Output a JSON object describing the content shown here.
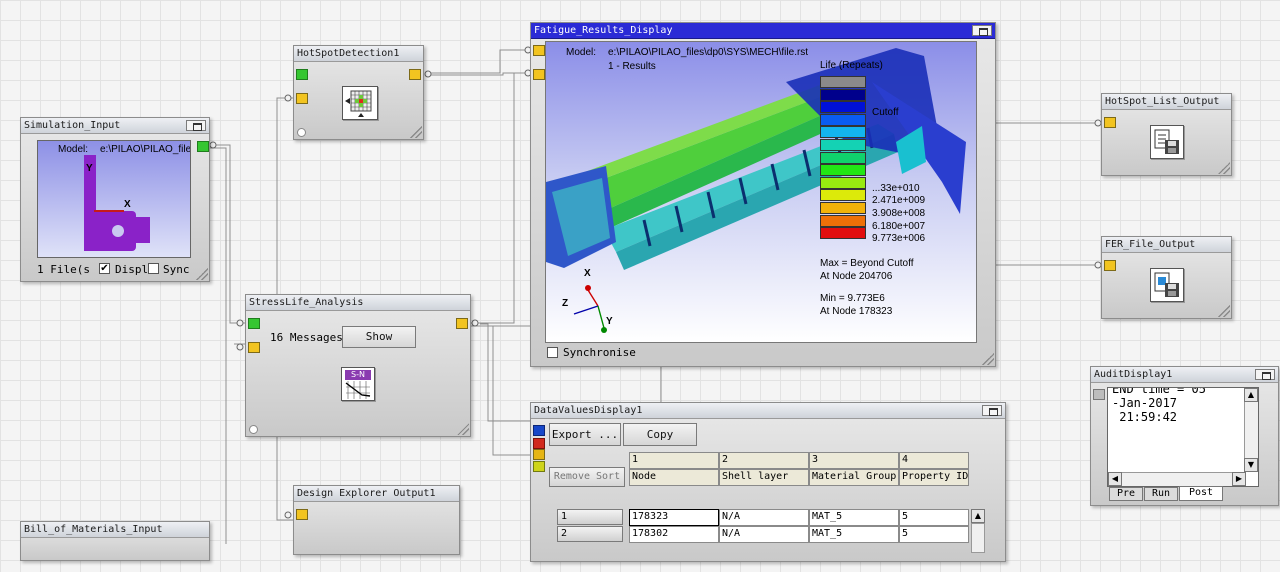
{
  "colors": {
    "port_yellow": "#f2c420",
    "port_green": "#35c631",
    "title_blue": "#2b2bd6",
    "wire": "#8a8a8a"
  },
  "simulation_input": {
    "title": "Simulation_Input",
    "model_label": "Model:",
    "model_path": "e:\\PILAO\\PILAO_file",
    "axis_y": "Y",
    "axis_x": "X",
    "files": "1 File(s",
    "display_label": "Displ",
    "sync_label": "Sync"
  },
  "hotspot_detection": {
    "title": "HotSpotDetection1",
    "icon": "hotspot-grid-icon"
  },
  "stresslife": {
    "title": "StressLife_Analysis",
    "messages": "16 Messages",
    "show_button": "Show",
    "icon_text": "S-N"
  },
  "design_explorer": {
    "title": "Design Explorer Output1"
  },
  "bill_of_materials": {
    "title": "Bill_of_Materials_Input"
  },
  "fatigue": {
    "title": "Fatigue_Results_Display",
    "model_label": "Model:",
    "model_path": "e:\\PILAO\\PILAO_files\\dp0\\SYS\\MECH\\file.rst",
    "results": "1 - Results",
    "legend_title": "Life (Repeats)",
    "legend_items": [
      {
        "label": "",
        "color": "#8a8a8a"
      },
      {
        "label": "",
        "color": "#00008c"
      },
      {
        "label": "Cutoff",
        "color": "#0010d8"
      },
      {
        "label": "",
        "color": "#0a5cf2"
      },
      {
        "label": "",
        "color": "#13b4ee"
      },
      {
        "label": "",
        "color": "#14d2b4"
      },
      {
        "label": "",
        "color": "#10d26c"
      },
      {
        "label": "",
        "color": "#22e614"
      },
      {
        "label": "...33e+010",
        "color": "#98ea10"
      },
      {
        "label": "2.471e+009",
        "color": "#dcea0a"
      },
      {
        "label": "3.908e+008",
        "color": "#f2b20a"
      },
      {
        "label": "6.180e+007",
        "color": "#ee7008"
      },
      {
        "label": "9.773e+006",
        "color": "#e20e0e"
      }
    ],
    "max_line": "Max = Beyond Cutoff",
    "max_node": "At Node 204706",
    "min_line": "Min = 9.773E6",
    "min_node": "At Node 178323",
    "axis_x": "X",
    "axis_y": "Y",
    "axis_z": "Z",
    "synchronise": "Synchronise"
  },
  "hotspot_list_output": {
    "title": "HotSpot_List_Output"
  },
  "fer_file_output": {
    "title": "FER_File_Output"
  },
  "audit_display": {
    "title": "AuditDisplay1",
    "lines": [
      "END time = 05",
      "-Jan-2017",
      " 21:59:42"
    ],
    "tabs": [
      "Pre",
      "Run",
      "Post"
    ],
    "active_tab": "Post"
  },
  "data_values": {
    "title": "DataValuesDisplay1",
    "export_button": "Export ...",
    "copy_button": "Copy",
    "remove_sort_button": "Remove Sort",
    "column_numbers": [
      "1",
      "2",
      "3",
      "4"
    ],
    "column_headers": [
      "Node",
      "Shell layer",
      "Material Group",
      "Property ID"
    ],
    "rows": [
      {
        "index": "1",
        "cells": [
          "178323",
          "N/A",
          "MAT_5",
          "5"
        ]
      },
      {
        "index": "2",
        "cells": [
          "178302",
          "N/A",
          "MAT_5",
          "5"
        ]
      }
    ]
  }
}
